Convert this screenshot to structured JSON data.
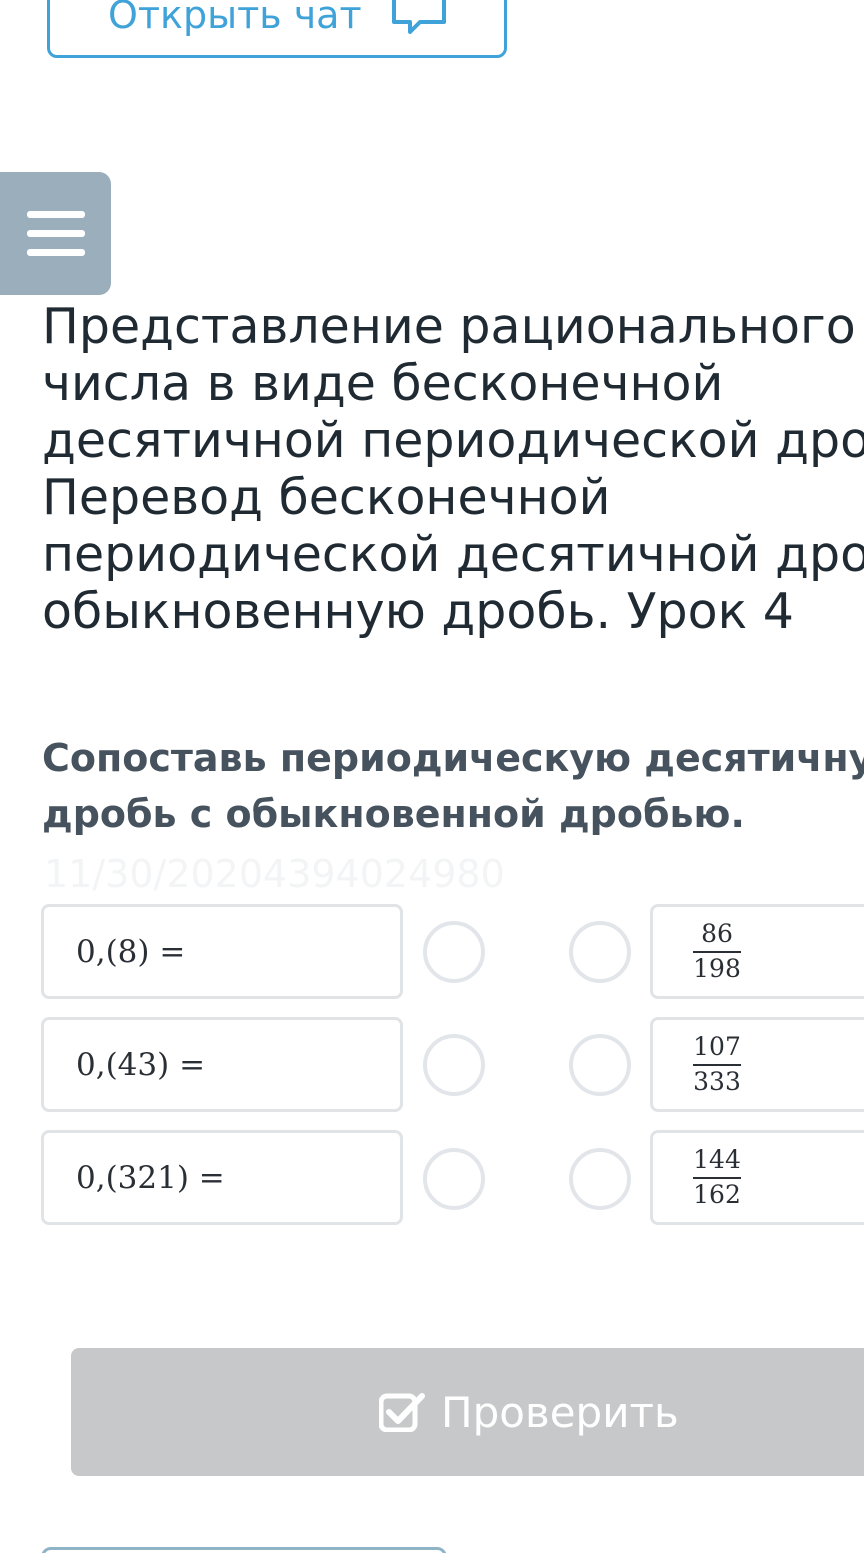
{
  "chat_button": {
    "label": "Открыть чат",
    "icon": "chat-bubble-icon"
  },
  "menu_button": {
    "icon": "hamburger-menu-icon"
  },
  "lesson": {
    "title": "Представление рационального\nчисла в виде бесконечной\nдесятичной периодической дроби.\nПеревод бесконечной\nпериодической десятичной дроби в\nобыкновенную дробь. Урок 4"
  },
  "task": {
    "prompt": "Сопоставь периодическую десятичную\nдробь с обыкновенной дробью.",
    "id": "11/30/20204394024980",
    "left_items": [
      "0,(8) =",
      "0,(43) =",
      "0,(321) ="
    ],
    "right_items": [
      {
        "numerator": "86",
        "denominator": "198"
      },
      {
        "numerator": "107",
        "denominator": "333"
      },
      {
        "numerator": "144",
        "denominator": "162"
      }
    ]
  },
  "check_button": {
    "label": "Проверить",
    "icon": "checkbox-icon"
  },
  "colors": {
    "accent": "#3fa3d9",
    "menu_bg": "#9aaebb",
    "disabled_button": "#c7c8c9",
    "border": "#e1e4e7"
  }
}
